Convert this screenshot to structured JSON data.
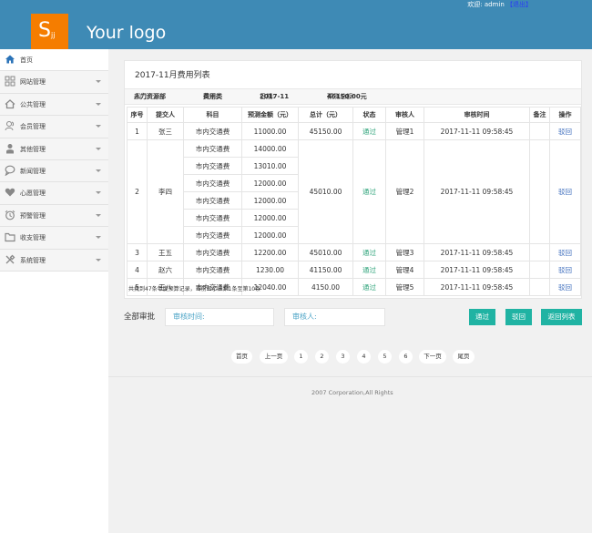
{
  "header": {
    "logo_letter": "S",
    "logo_sub": "jj",
    "logo_text": "Your logo",
    "welcome_prefix": "欢迎:",
    "username": "admin",
    "logout": "【退出】"
  },
  "sidebar": {
    "items": [
      {
        "label": "首页",
        "icon": "home-icon"
      },
      {
        "label": "网站管理",
        "icon": "grid-icon"
      },
      {
        "label": "公共管理",
        "icon": "house-icon"
      },
      {
        "label": "会员管理",
        "icon": "users-icon"
      },
      {
        "label": "其他管理",
        "icon": "person-icon"
      },
      {
        "label": "新闻管理",
        "icon": "chat-icon"
      },
      {
        "label": "心愿管理",
        "icon": "heart-icon"
      },
      {
        "label": "预警管理",
        "icon": "alarm-icon"
      },
      {
        "label": "收支管理",
        "icon": "folder-icon"
      },
      {
        "label": "系统管理",
        "icon": "tools-icon"
      }
    ]
  },
  "card": {
    "title": "2017-11月费用列表",
    "info": {
      "dept_label": "部门:",
      "dept": "人力资源部",
      "type_label": "类别:",
      "type": "费用类",
      "date_label": "日期:",
      "date": "2017-11",
      "total_label": "预测总额:",
      "total": "46150.00元"
    },
    "columns": [
      "序号",
      "提交人",
      "科目",
      "预测金额（元）",
      "总计（元）",
      "状态",
      "审核人",
      "审核时间",
      "备注",
      "操作"
    ],
    "rows": [
      {
        "no": "1",
        "submitter": "张三",
        "subjects": [
          "市内交通费"
        ],
        "amounts": [
          "11000.00"
        ],
        "total": "45150.00",
        "status": "通过",
        "reviewer": "管理1",
        "time": "2017-11-11 09:58:45",
        "note": "",
        "action": "驳回"
      },
      {
        "no": "2",
        "submitter": "李四",
        "subjects": [
          "市内交通费",
          "市内交通费",
          "市内交通费",
          "市内交通费",
          "市内交通费",
          "市内交通费"
        ],
        "amounts": [
          "14000.00",
          "13010.00",
          "12000.00",
          "12000.00",
          "12000.00",
          "12000.00"
        ],
        "total": "45010.00",
        "status": "通过",
        "reviewer": "管理2",
        "time": "2017-11-11 09:58:45",
        "note": "",
        "action": "驳回"
      },
      {
        "no": "3",
        "submitter": "王五",
        "subjects": [
          "市内交通费"
        ],
        "amounts": [
          "12200.00"
        ],
        "total": "45010.00",
        "status": "通过",
        "reviewer": "管理3",
        "time": "2017-11-11 09:58:45",
        "note": "",
        "action": "驳回"
      },
      {
        "no": "4",
        "submitter": "赵六",
        "subjects": [
          "市内交通费"
        ],
        "amounts": [
          "1230.00"
        ],
        "total": "41150.00",
        "status": "通过",
        "reviewer": "管理4",
        "time": "2017-11-11 09:58:45",
        "note": "",
        "action": "驳回"
      },
      {
        "no": "5",
        "submitter": "王八",
        "subjects": [
          "市内交通费"
        ],
        "amounts": [
          "12040.00"
        ],
        "total": "4150.00",
        "status": "通过",
        "reviewer": "管理5",
        "time": "2017-11-11 09:58:45",
        "note": "",
        "action": "驳回"
      }
    ],
    "footnote": "共找到47条年度预算记录，当前显示从第1条至第10条"
  },
  "batch": {
    "label": "全部审批",
    "time_placeholder": "审核时间:",
    "reviewer_placeholder": "审核人:",
    "pass": "通过",
    "reject": "驳回",
    "back": "返回列表"
  },
  "pagination": {
    "first": "首页",
    "prev": "上一页",
    "pages": [
      "1",
      "2",
      "3",
      "4",
      "5",
      "6"
    ],
    "next": "下一页",
    "last": "尾页"
  },
  "footer": "2007 Corporation,All Rights",
  "colors": {
    "header_bg": "#3e8ab5",
    "logo_bg": "#f57d00",
    "button_bg": "#20b3a3",
    "pass_text": "#2ea37a",
    "link_text": "#3e6ebd"
  }
}
